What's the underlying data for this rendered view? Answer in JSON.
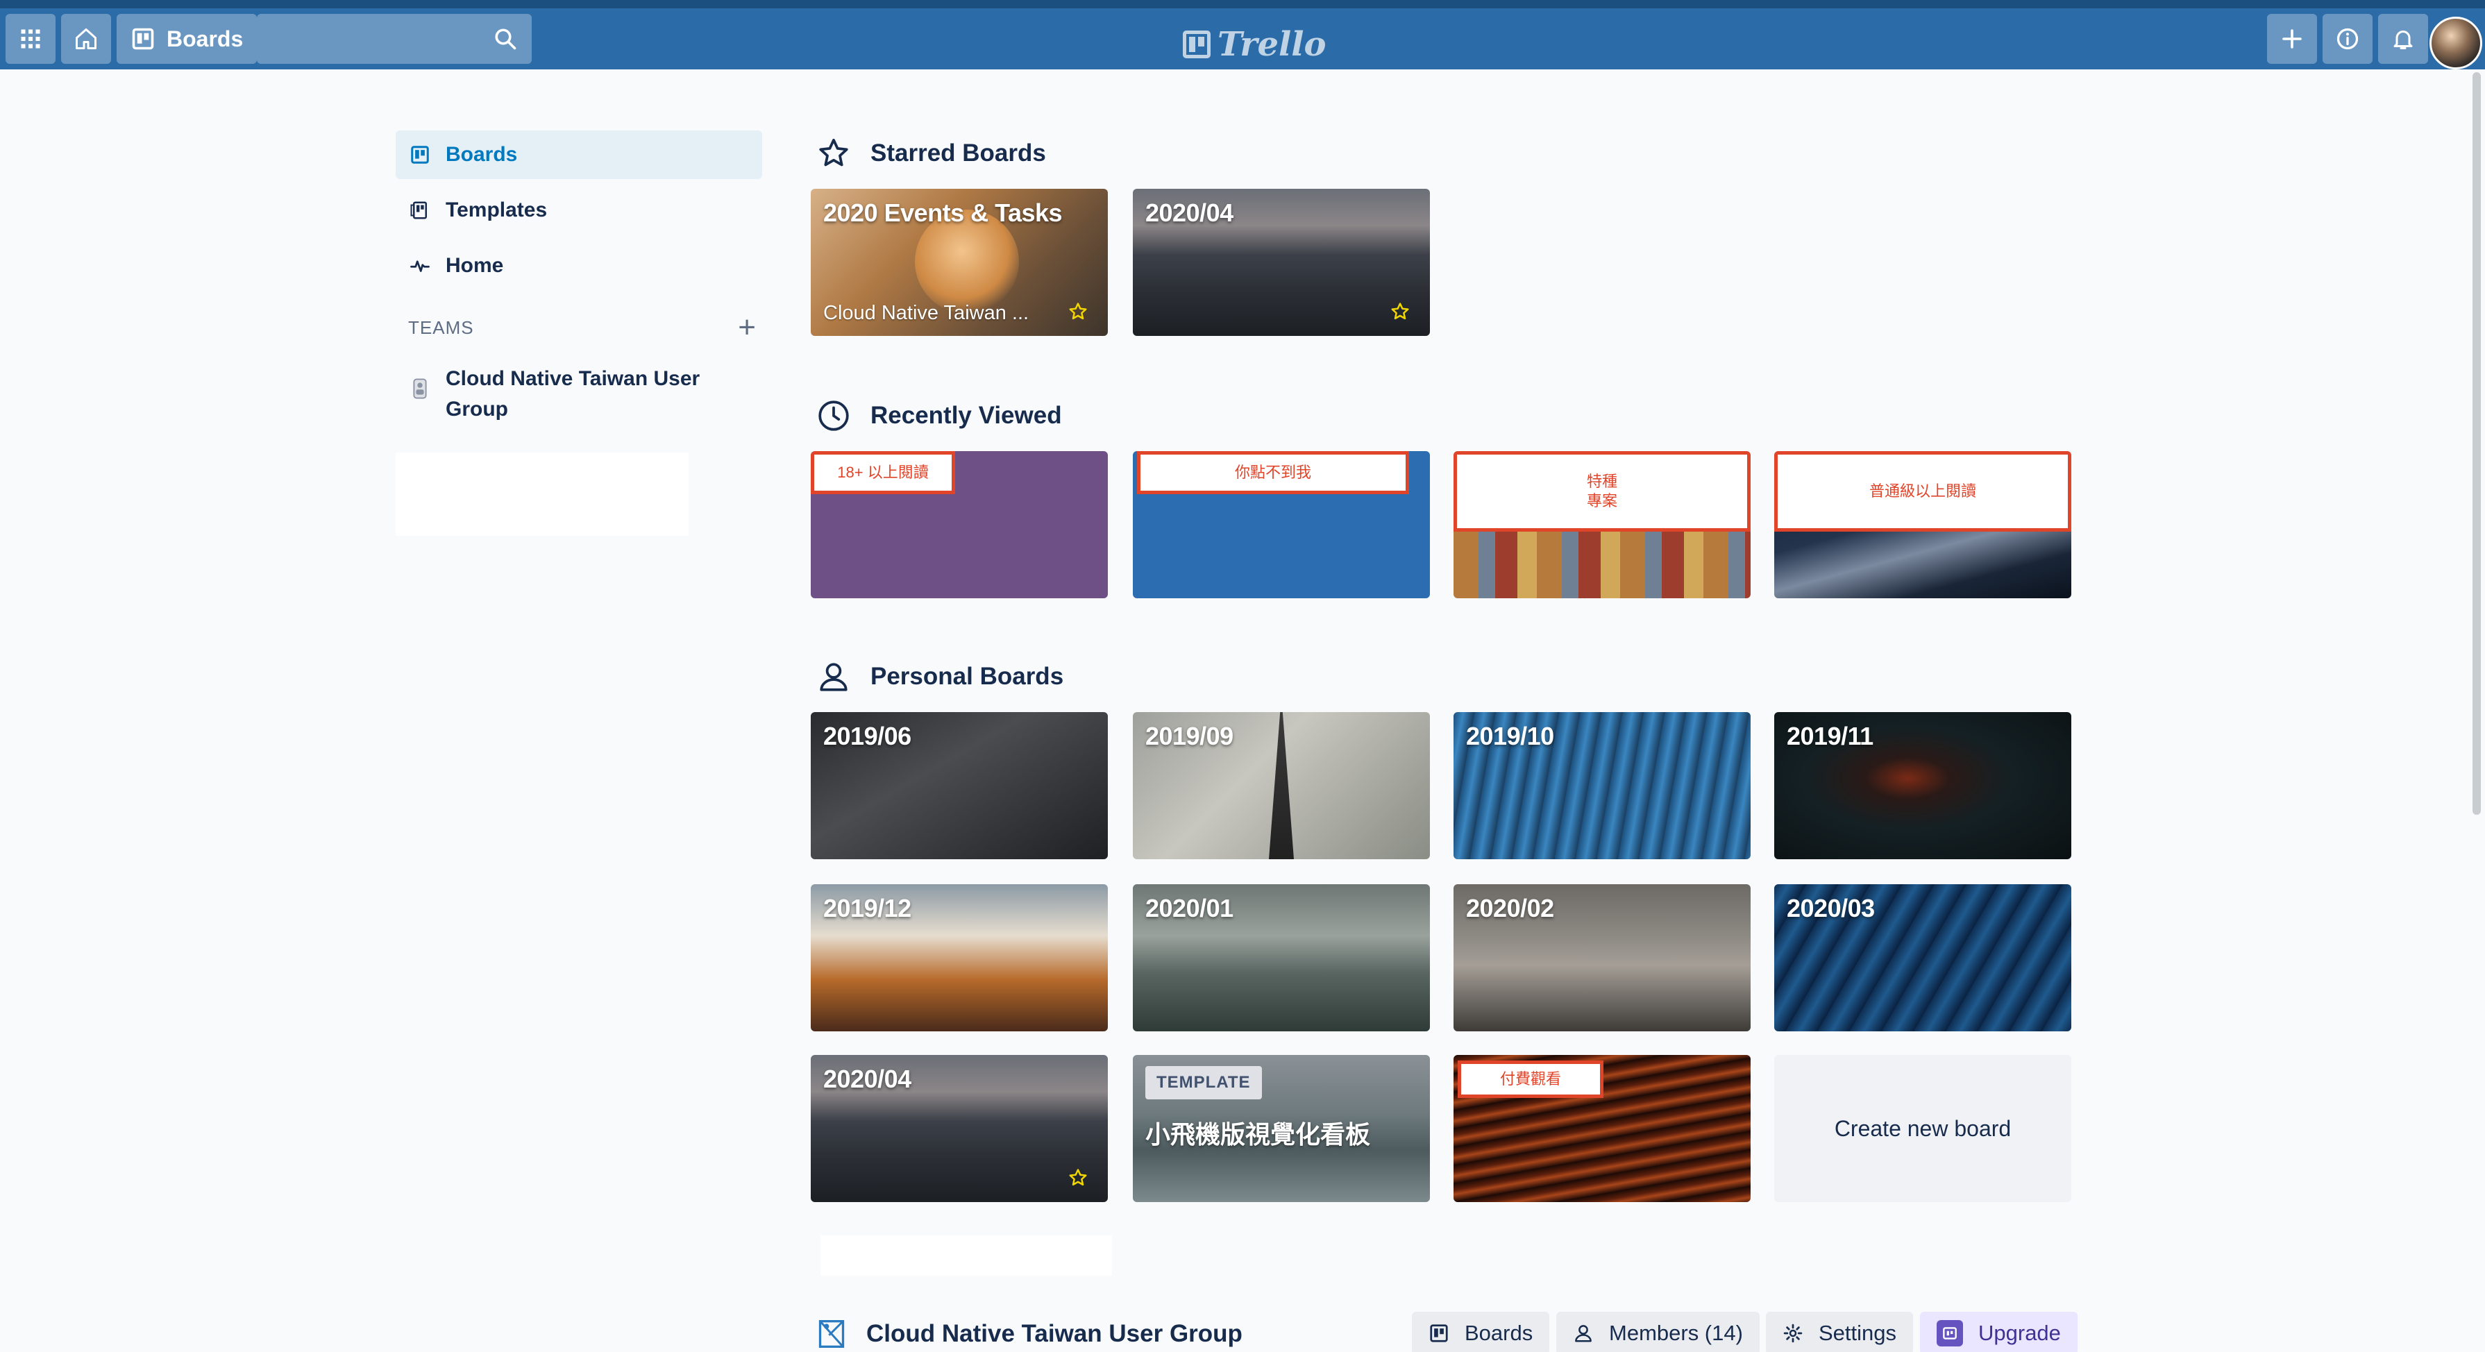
{
  "header": {
    "boards_label": "Boards",
    "logo_text": "Trello",
    "icons": [
      "apps-grid-icon",
      "home-icon",
      "boards-icon",
      "search-icon",
      "plus-icon",
      "info-icon",
      "bell-icon"
    ]
  },
  "sidebar": {
    "items": [
      {
        "label": "Boards",
        "icon": "boards-icon",
        "active": true
      },
      {
        "label": "Templates",
        "icon": "templates-icon",
        "active": false
      },
      {
        "label": "Home",
        "icon": "activity-icon",
        "active": false
      }
    ],
    "teams_heading": "TEAMS",
    "teams": [
      {
        "name": "Cloud Native Taiwan User Group"
      }
    ]
  },
  "main": {
    "starred": {
      "heading": "Starred Boards",
      "boards": [
        {
          "title": "2020 Events & Tasks",
          "subtitle": "Cloud Native Taiwan ...",
          "starred": true
        },
        {
          "title": "2020/04",
          "subtitle": "",
          "starred": true
        }
      ]
    },
    "recent": {
      "heading": "Recently Viewed",
      "boards": [
        {
          "label": "18+ 以上閱讀",
          "color": "#6e5087"
        },
        {
          "label": "你點不到我",
          "color": "#2b6db0"
        },
        {
          "label": "特種\n專案",
          "color": "#9b6a3c"
        },
        {
          "label": "普通級以上閱讀",
          "color": "#1f2f44"
        }
      ]
    },
    "personal": {
      "heading": "Personal Boards",
      "boards": [
        {
          "title": "2019/06"
        },
        {
          "title": "2019/09"
        },
        {
          "title": "2019/10"
        },
        {
          "title": "2019/11"
        },
        {
          "title": "2019/12"
        },
        {
          "title": "2020/01"
        },
        {
          "title": "2020/02"
        },
        {
          "title": "2020/03"
        },
        {
          "title": "2020/04",
          "starred": true
        },
        {
          "badge": "TEMPLATE",
          "title": "小飛機版視覺化看板"
        },
        {
          "label": "付費觀看"
        }
      ],
      "create_label": "Create new board"
    },
    "team_section": {
      "name": "Cloud Native Taiwan User Group",
      "buttons": [
        {
          "label": "Boards",
          "icon": "boards-icon"
        },
        {
          "label": "Members (14)",
          "icon": "person-icon"
        },
        {
          "label": "Settings",
          "icon": "gear-icon"
        },
        {
          "label": "Upgrade",
          "icon": "upgrade-icon"
        }
      ]
    }
  },
  "colors": {
    "header_bg": "#2a6ba8",
    "accent": "#0079bf",
    "label_border": "#e0452a"
  }
}
